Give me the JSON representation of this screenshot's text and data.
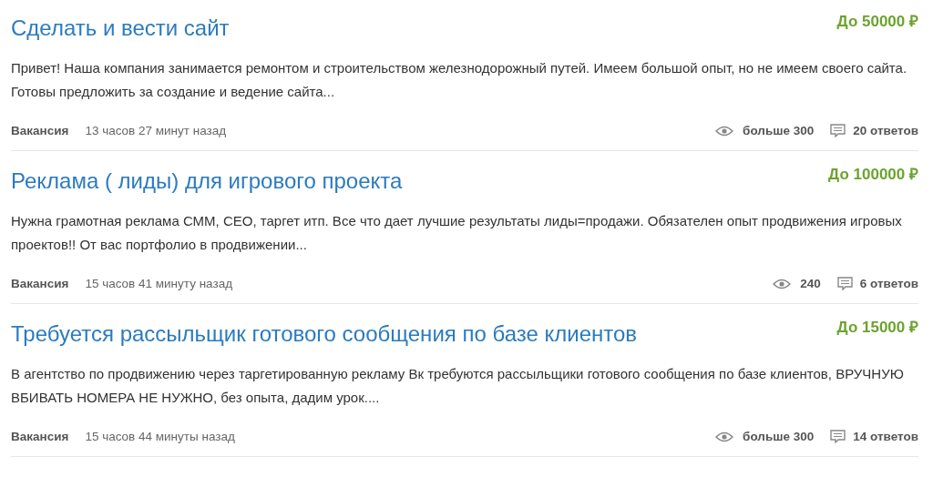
{
  "jobs": [
    {
      "title": "Сделать и вести сайт",
      "price": "До 50000 ₽",
      "description": "Привет! Наша компания занимается ремонтом и строительством железнодорожный путей. Имеем большой опыт, но не имеем своего сайта. Готовы предложить за создание и ведение сайта...",
      "type": "Вакансия",
      "time": "13 часов 27 минут назад",
      "views": "больше 300",
      "replies": "20 ответов"
    },
    {
      "title": "Реклама ( лиды) для игрового проекта",
      "price": "До 100000 ₽",
      "description": "Нужна грамотная реклама  СММ, СЕО, таргет итп. Все что дает лучшие результаты лиды=продажи. Обязателен опыт продвижения игровых проектов!! От вас портфолио в продвижении...",
      "type": "Вакансия",
      "time": "15 часов 41 минуту назад",
      "views": "240",
      "replies": "6 ответов"
    },
    {
      "title": "Требуется рассыльщик готового сообщения по базе клиентов",
      "price": "До 15000 ₽",
      "description": "В агентство по продвижению через таргетированную рекламу Вк требуются рассыльщики готового сообщения по базе клиентов, ВРУЧНУЮ ВБИВАТЬ НОМЕРА НЕ НУЖНО, без опыта, дадим урок....",
      "type": "Вакансия",
      "time": "15 часов 44 минуты назад",
      "views": "больше 300",
      "replies": "14 ответов"
    }
  ]
}
